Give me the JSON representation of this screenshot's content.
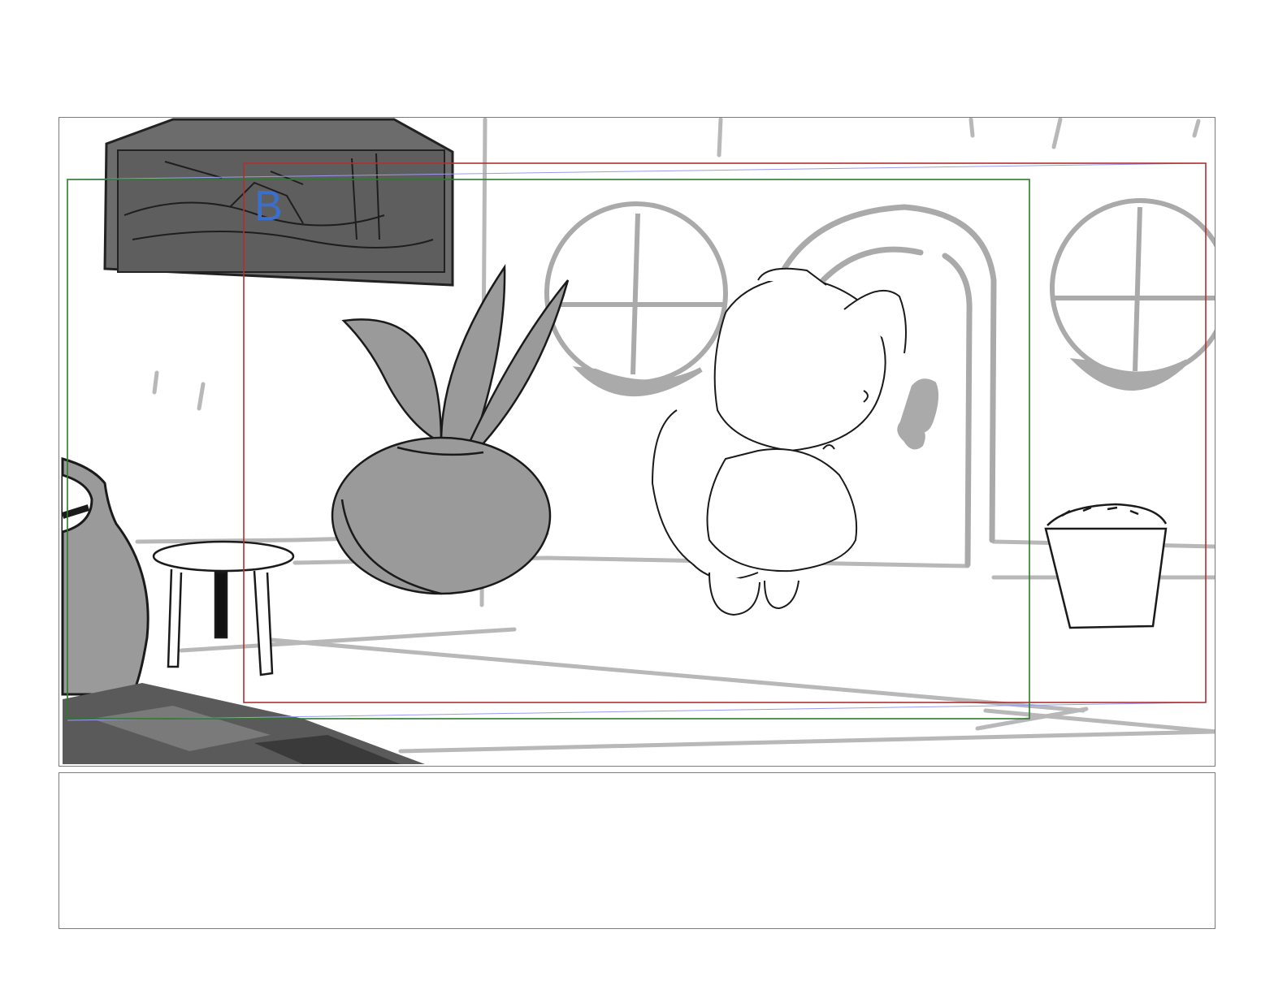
{
  "storyboard": {
    "panel": {
      "layer_label": "B",
      "scene_elements": [
        "wall-painting",
        "potted-plant",
        "cat-character",
        "round-window-left",
        "round-window-right",
        "arched-door",
        "stool",
        "vase",
        "bucket",
        "rug"
      ],
      "frame_colors": {
        "border": "#7a7a7a",
        "camera_frame_red": "#b03030",
        "camera_frame_green": "#2e7a2e",
        "guide_line": "#9a9af0",
        "label": "#3a6fd0"
      }
    },
    "notes": {
      "text": ""
    }
  }
}
